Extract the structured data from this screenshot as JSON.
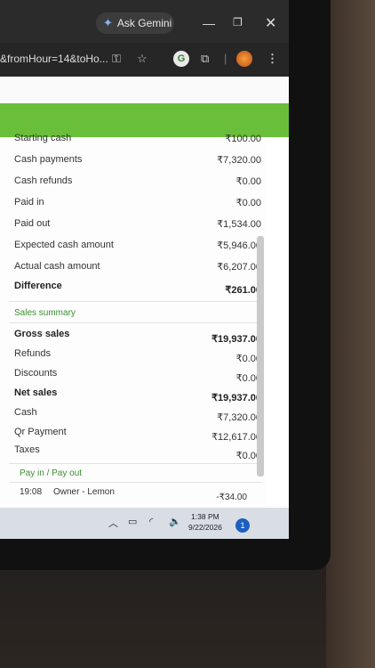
{
  "browser": {
    "gemini_label": "Ask Gemini",
    "url": "&fromHour=14&toHo...",
    "extension_badge": "G"
  },
  "report": {
    "cash_rows": [
      {
        "label": "Starting cash",
        "value": "₹100.00"
      },
      {
        "label": "Cash payments",
        "value": "₹7,320.00"
      },
      {
        "label": "Cash refunds",
        "value": "₹0.00"
      },
      {
        "label": "Paid in",
        "value": "₹0.00"
      },
      {
        "label": "Paid out",
        "value": "₹1,534.00"
      },
      {
        "label": "Expected cash amount",
        "value": "₹5,946.00"
      },
      {
        "label": "Actual cash amount",
        "value": "₹6,207.00"
      },
      {
        "label": "Difference",
        "value": "₹261.00"
      }
    ],
    "sales_title": "Sales summary",
    "sales_rows": [
      {
        "label": "Gross sales",
        "value": "₹19,937.00"
      },
      {
        "label": "Refunds",
        "value": "₹0.00"
      },
      {
        "label": "Discounts",
        "value": "₹0.00"
      },
      {
        "label": "Net sales",
        "value": "₹19,937.00"
      },
      {
        "label": "Cash",
        "value": "₹7,320.00"
      },
      {
        "label": "Qr Payment",
        "value": "₹12,617.00"
      },
      {
        "label": "Taxes",
        "value": "₹0.00"
      }
    ],
    "payinout_title": "Pay in / Pay out",
    "payinout_rows": [
      {
        "time": "19:08",
        "who": "Owner - Lemon",
        "value": "-₹34.00"
      }
    ]
  },
  "taskbar": {
    "time": "1:38 PM",
    "date": "9/22/2026",
    "notification_count": "1"
  },
  "colors": {
    "header_green": "#6abf3a",
    "section_green": "#3a8f2f"
  }
}
